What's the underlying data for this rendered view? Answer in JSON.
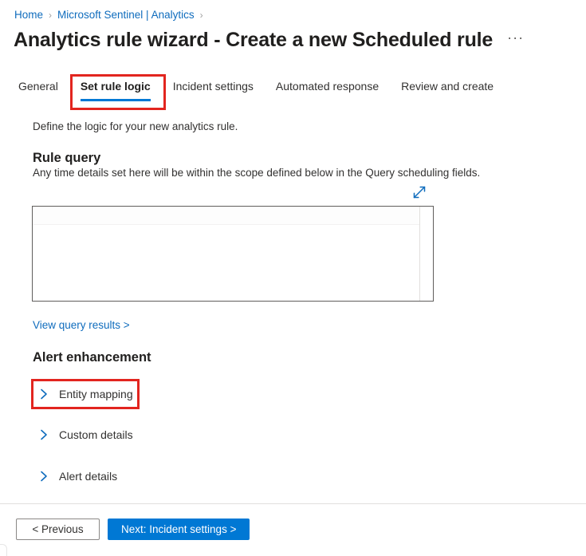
{
  "breadcrumb": {
    "items": [
      {
        "label": "Home"
      },
      {
        "label": "Microsoft Sentinel | Analytics"
      }
    ],
    "separator": "›"
  },
  "header": {
    "title": "Analytics rule wizard - Create a new Scheduled rule",
    "more_menu": "···"
  },
  "tabs": [
    {
      "label": "General",
      "active": false
    },
    {
      "label": "Set rule logic",
      "active": true
    },
    {
      "label": "Incident settings",
      "active": false
    },
    {
      "label": "Automated response",
      "active": false
    },
    {
      "label": "Review and create",
      "active": false
    }
  ],
  "main": {
    "subtitle": "Define the logic for your new analytics rule.",
    "rule_query": {
      "heading": "Rule query",
      "description": "Any time details set here will be within the scope defined below in the Query scheduling fields.",
      "expand_icon": "expand-diagonal-icon",
      "editor_value": "",
      "editor_placeholder": ""
    },
    "view_query_results_link": "View query results >",
    "alert_enhancement": {
      "heading": "Alert enhancement",
      "sections": [
        {
          "label": "Entity mapping",
          "icon": "chevron-right-icon",
          "expanded": false
        },
        {
          "label": "Custom details",
          "icon": "chevron-right-icon",
          "expanded": false
        },
        {
          "label": "Alert details",
          "icon": "chevron-right-icon",
          "expanded": false
        }
      ]
    }
  },
  "footer": {
    "previous_label": "< Previous",
    "next_label": "Next: Incident settings >"
  },
  "annotations": [
    {
      "name": "set-rule-logic-tab-highlight",
      "color": "#e2251f"
    },
    {
      "name": "entity-mapping-highlight",
      "color": "#e2251f"
    }
  ],
  "colors": {
    "accent": "#0078d4",
    "link": "#0f6cbd",
    "annotation": "#e2251f",
    "text": "#323130"
  }
}
